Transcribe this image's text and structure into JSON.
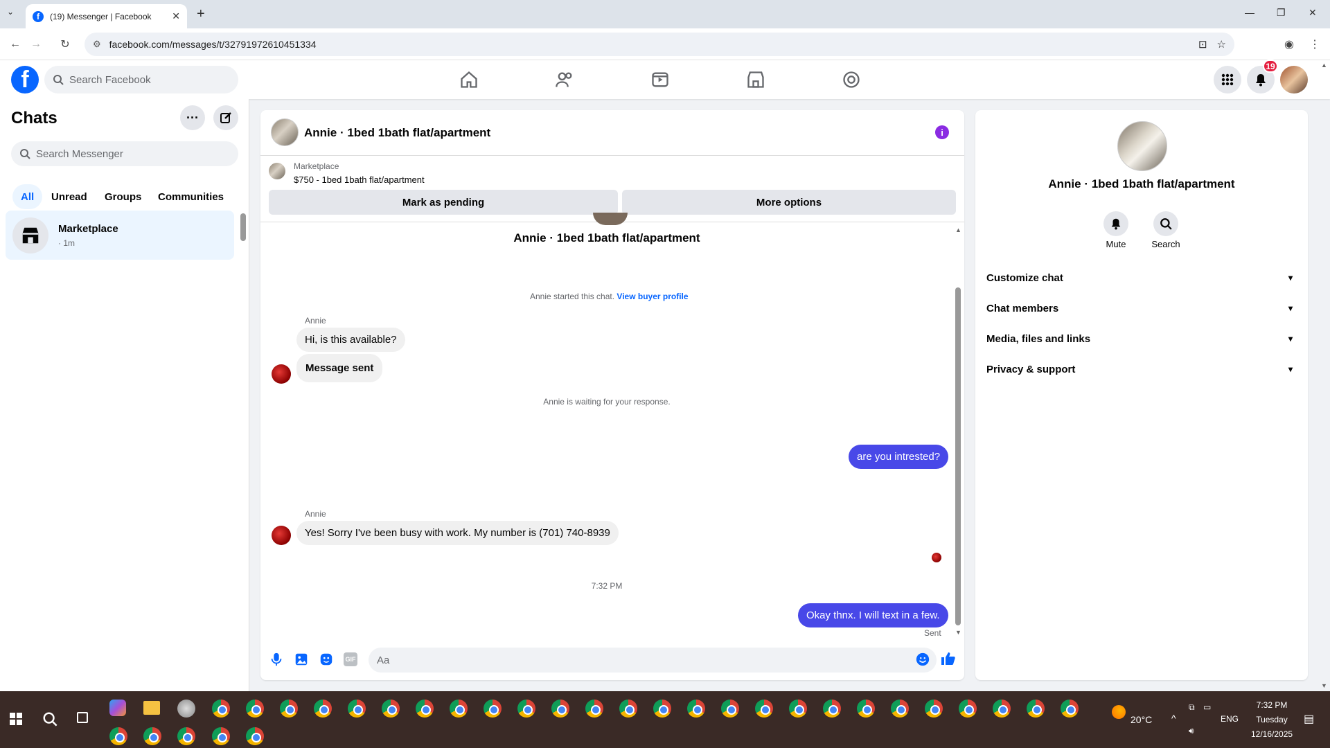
{
  "browser": {
    "tab_title": "(19) Messenger | Facebook",
    "url": "facebook.com/messages/t/32791972610451334"
  },
  "fb_header": {
    "search_placeholder": "Search Facebook",
    "notification_count": "19"
  },
  "chats_panel": {
    "title": "Chats",
    "search_placeholder": "Search Messenger",
    "filters": [
      "All",
      "Unread",
      "Groups",
      "Communities"
    ],
    "items": [
      {
        "name": "Marketplace",
        "time": "· 1m"
      }
    ]
  },
  "conversation": {
    "title": "Annie · 1bed 1bath flat/apartment",
    "marketplace_label": "Marketplace",
    "listing": "$750 - 1bed 1bath flat/apartment",
    "mark_pending": "Mark as pending",
    "more_options": "More options",
    "thread_title": "Annie · 1bed 1bath flat/apartment",
    "started_text": "Annie started this chat.",
    "buyer_profile_link": "View buyer profile",
    "sender1": "Annie",
    "msg1": "Hi, is this available?",
    "msg2": "Message sent",
    "waiting_text": "Annie is waiting for your response.",
    "msg3": "are you intrested?",
    "sender2": "Annie",
    "msg4": "Yes! Sorry I've been busy with work. My number is (701) 740-8939",
    "timestamp": "7:32 PM",
    "msg5": "Okay thnx. I will text in a few.",
    "sent_status": "Sent",
    "composer_placeholder": "Aa"
  },
  "details_panel": {
    "name": "Annie · 1bed 1bath flat/apartment",
    "mute_label": "Mute",
    "search_label": "Search",
    "sections": [
      "Customize chat",
      "Chat members",
      "Media, files and links",
      "Privacy & support"
    ]
  },
  "taskbar": {
    "temperature": "20°C",
    "language": "ENG",
    "time": "7:32 PM",
    "day": "Tuesday",
    "date": "12/16/2025"
  },
  "colors": {
    "fb_blue": "#0866ff",
    "outgoing_bubble": "#4848e8",
    "info_purple": "#8a2be2"
  }
}
